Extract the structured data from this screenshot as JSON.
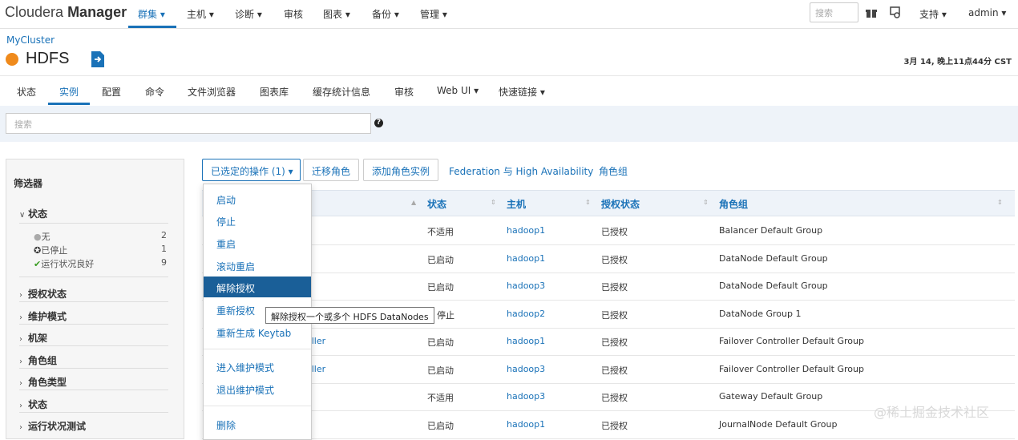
{
  "brand": {
    "prefix": "Cloudera",
    "name": "Manager"
  },
  "nav": [
    {
      "label": "群集 ▾"
    },
    {
      "label": "主机 ▾"
    },
    {
      "label": "诊断 ▾"
    },
    {
      "label": "审核"
    },
    {
      "label": "图表 ▾"
    },
    {
      "label": "备份 ▾"
    },
    {
      "label": "管理 ▾"
    }
  ],
  "topright": {
    "search_placeholder": "搜索",
    "support": "支持 ▾",
    "user": "admin ▾"
  },
  "cluster": "MyCluster",
  "service": {
    "name": "HDFS",
    "status_color": "#ef8a1c"
  },
  "timestamp": "3月 14, 晚上11点44分 CST",
  "tabs": [
    "状态",
    "实例",
    "配置",
    "命令",
    "文件浏览器",
    "图表库",
    "缓存统计信息",
    "审核",
    "Web UI ▾",
    "快速链接 ▾"
  ],
  "search": {
    "placeholder": "搜索",
    "help": "?"
  },
  "filters": {
    "title": "筛选器",
    "status_head": "状态",
    "status_items": [
      {
        "icon": "●",
        "label": "无",
        "count": "2",
        "color": "#aaaaaa"
      },
      {
        "icon": "✪",
        "label": "已停止",
        "count": "1",
        "color": "#333333"
      },
      {
        "icon": "✔",
        "label": "运行状况良好",
        "count": "9",
        "color": "#3a9d23"
      }
    ],
    "sections": [
      "授权状态",
      "维护模式",
      "机架",
      "角色组",
      "角色类型",
      "状态",
      "运行状况测试"
    ]
  },
  "actions": {
    "selected": "已选定的操作 (1) ▾",
    "migrate": "迁移角色",
    "add": "添加角色实例",
    "federation": "Federation 与 High Availability",
    "rolegroups": "角色组"
  },
  "table": {
    "headers": [
      "状态",
      "主机",
      "授权状态",
      "角色组"
    ],
    "rows": [
      {
        "name": "",
        "status": "不适用",
        "host": "hadoop1",
        "commission": "已授权",
        "group": "Balancer Default Group"
      },
      {
        "name": "",
        "status": "已启动",
        "host": "hadoop1",
        "commission": "已授权",
        "group": "DataNode Default Group"
      },
      {
        "name": "",
        "status": "已启动",
        "host": "hadoop3",
        "commission": "已授权",
        "group": "DataNode Default Group"
      },
      {
        "name": "",
        "status": "停止",
        "host": "hadoop2",
        "commission": "已授权",
        "group": "DataNode Group 1"
      },
      {
        "name": "oller",
        "status": "已启动",
        "host": "hadoop1",
        "commission": "已授权",
        "group": "Failover Controller Default Group"
      },
      {
        "name": "oller",
        "status": "已启动",
        "host": "hadoop3",
        "commission": "已授权",
        "group": "Failover Controller Default Group"
      },
      {
        "name": "",
        "status": "不适用",
        "host": "hadoop3",
        "commission": "已授权",
        "group": "Gateway Default Group"
      },
      {
        "name": "",
        "status": "已启动",
        "host": "hadoop1",
        "commission": "已授权",
        "group": "JournalNode Default Group"
      }
    ]
  },
  "menu": {
    "items_a": [
      "启动",
      "停止",
      "重启",
      "滚动重启",
      "解除授权",
      "重新授权",
      "重新生成 Keytab"
    ],
    "items_b": [
      "进入维护模式",
      "退出维护模式"
    ],
    "items_c": [
      "删除"
    ],
    "highlighted": "解除授权"
  },
  "tooltip": "解除授权一个或多个 HDFS DataNodes",
  "watermark": "@稀土掘金技术社区"
}
